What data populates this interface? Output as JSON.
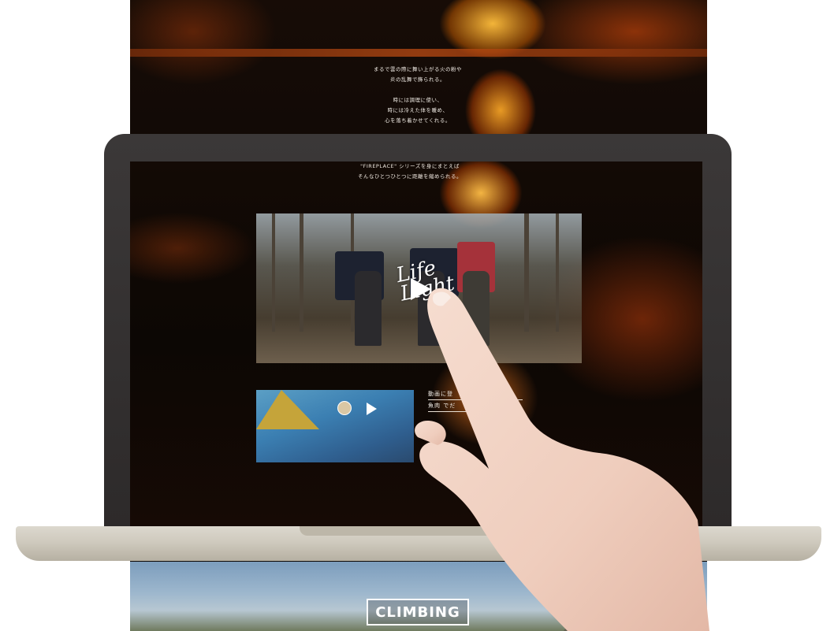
{
  "page": {
    "top_text": [
      "まるで雲の際に舞い上がる火の粉や",
      "炎の乱舞で飾られる。",
      "",
      "時には調理に使い、",
      "時には冷えた体を暖め、",
      "心を落ち着かせてくれる。"
    ],
    "bottom_banner": "CLIMBING"
  },
  "screen": {
    "top_text": [
      "\"FIREPLACE\" シリーズを身にまとえば",
      "そんなひとつひとつに距離を縮められる。"
    ],
    "video_logo_line1": "Life",
    "video_logo_line2": "Light",
    "side_text": [
      "動画に登",
      "魚肉 でだ",
      "",
      "",
      "",
      "",
      "",
      ""
    ]
  },
  "colors": {
    "page_bg": "#0b0806",
    "fire": "#ff9a28",
    "laptop_frame": "#2d2a2a",
    "laptop_base": "#cfcabe"
  }
}
